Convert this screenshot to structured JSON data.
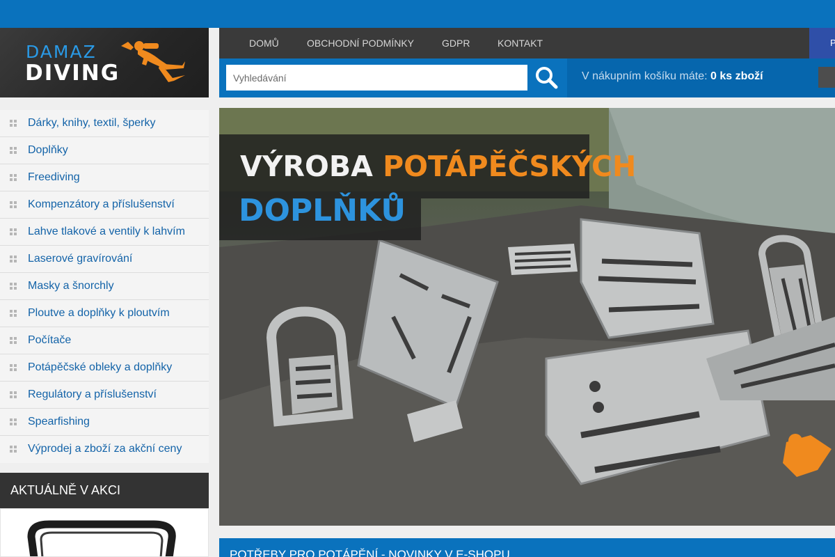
{
  "logo": {
    "line1": "DAMAZ",
    "line2": "DIVING"
  },
  "nav": {
    "items": [
      "DOMŮ",
      "OBCHODNÍ PODMÍNKY",
      "GDPR",
      "KONTAKT"
    ],
    "right_label": "P"
  },
  "search": {
    "placeholder": "Vyhledávání"
  },
  "cart": {
    "text": "V nákupním košíku máte:",
    "count": "0 ks zboží"
  },
  "categories": [
    "Dárky, knihy, textil, šperky",
    "Doplňky",
    "Freediving",
    "Kompenzátory a příslušenství",
    "Lahve tlakové a ventily k lahvím",
    "Laserové gravírování",
    "Masky a šnorchly",
    "Ploutve a doplňky k ploutvím",
    "Počítače",
    "Potápěčské obleky a doplňky",
    "Regulátory a příslušenství",
    "Spearfishing",
    "Výprodej a zboží za akční ceny"
  ],
  "sidebar": {
    "akce_heading": "AKTUÁLNĚ V AKCI"
  },
  "banner": {
    "word1": "VÝROBA",
    "word2": "POTÁPĚČSKÝCH",
    "word3": "DOPLŇKŮ"
  },
  "news": {
    "heading": "POTŘEBY PRO POTÁPĚNÍ - NOVINKY V E-SHOPU"
  },
  "colors": {
    "brand_blue": "#0a72bd",
    "accent_orange": "#f08a1e",
    "dark": "#333333"
  }
}
